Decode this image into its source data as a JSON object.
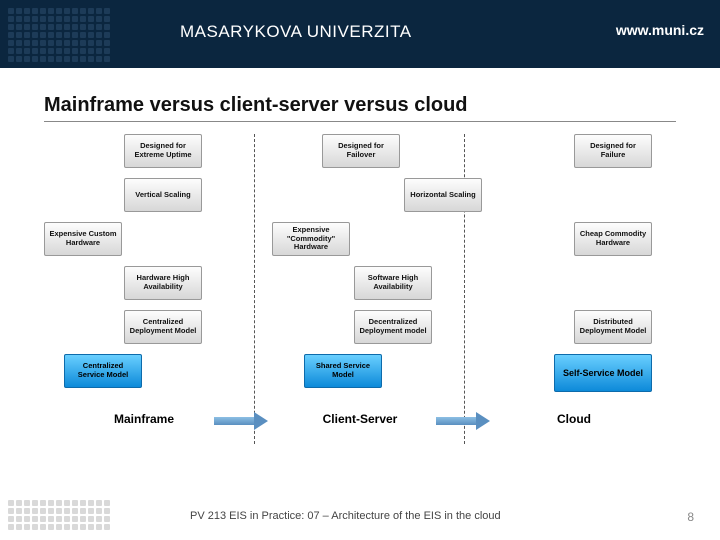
{
  "header": {
    "university": "MASARYKOVA UNIVERZITA",
    "url": "www.muni.cz"
  },
  "slide": {
    "title": "Mainframe versus client-server versus cloud"
  },
  "diagram": {
    "columns": [
      {
        "key": "mainframe",
        "label": "Mainframe",
        "boxes": {
          "design": "Designed for Extreme Uptime",
          "scale": "Vertical Scaling",
          "hw": "Expensive Custom Hardware",
          "avail": "Hardware High Availability",
          "deploy": "Centralized Deployment Model",
          "service": "Centralized Service Model"
        }
      },
      {
        "key": "clientserver",
        "label": "Client-Server",
        "boxes": {
          "design": "Designed for Failover",
          "scale": "Horizontal Scaling",
          "hw": "Expensive \"Commodity\" Hardware",
          "avail": "Software High Availability",
          "deploy": "Decentralized Deployment model",
          "service": "Shared Service Model"
        }
      },
      {
        "key": "cloud",
        "label": "Cloud",
        "boxes": {
          "design": "Designed for Failure",
          "scale": "Horizontal Scaling",
          "hw": "Cheap Commodity Hardware",
          "avail": "Software High Availability",
          "deploy": "Distributed Deployment Model",
          "service": "Self-Service Model"
        }
      }
    ],
    "rows": [
      "design",
      "scale",
      "hw",
      "avail",
      "deploy",
      "service"
    ]
  },
  "footer": {
    "course": "PV 213 EIS in Practice: 07 – Architecture of the EIS in the cloud",
    "page": "8"
  },
  "colors": {
    "header_bg": "#0b263f",
    "box_grey_top": "#fdfdfd",
    "box_grey_bot": "#d7d7d7",
    "box_blue_top": "#69cfff",
    "box_blue_bot": "#0d8ad9"
  }
}
